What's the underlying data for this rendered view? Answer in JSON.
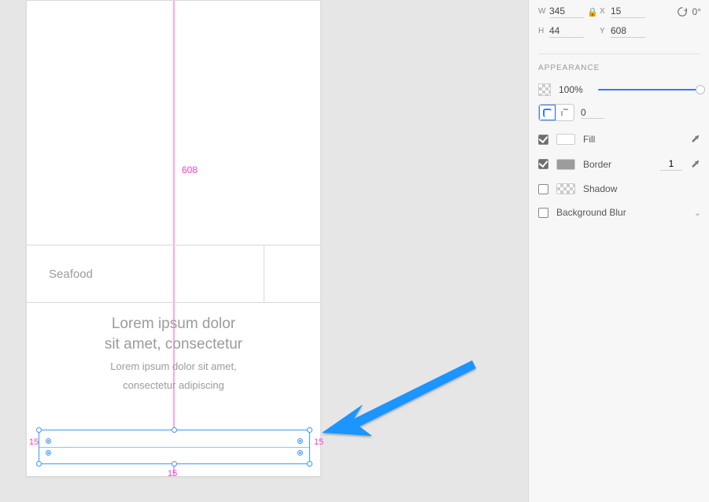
{
  "canvas": {
    "distance_y_label": "608",
    "distance_left": "15",
    "distance_right": "15",
    "distance_bottom": "15",
    "list_item": "Seafood",
    "lorem_title_line1": "Lorem ipsum dolor",
    "lorem_title_line2": "sit amet, consectetur",
    "lorem_sub_line1": "Lorem ipsum dolor sit amet,",
    "lorem_sub_line2": "consectetur adipiscing"
  },
  "inspector": {
    "w_label": "W",
    "w_value": "345",
    "h_label": "H",
    "h_value": "44",
    "x_label": "X",
    "x_value": "15",
    "y_label": "Y",
    "y_value": "608",
    "rotation": "0°",
    "appearance_title": "APPEARANCE",
    "opacity": "100%",
    "radius": "0",
    "fill_label": "Fill",
    "border_label": "Border",
    "border_width": "1",
    "shadow_label": "Shadow",
    "bgblur_label": "Background Blur"
  }
}
